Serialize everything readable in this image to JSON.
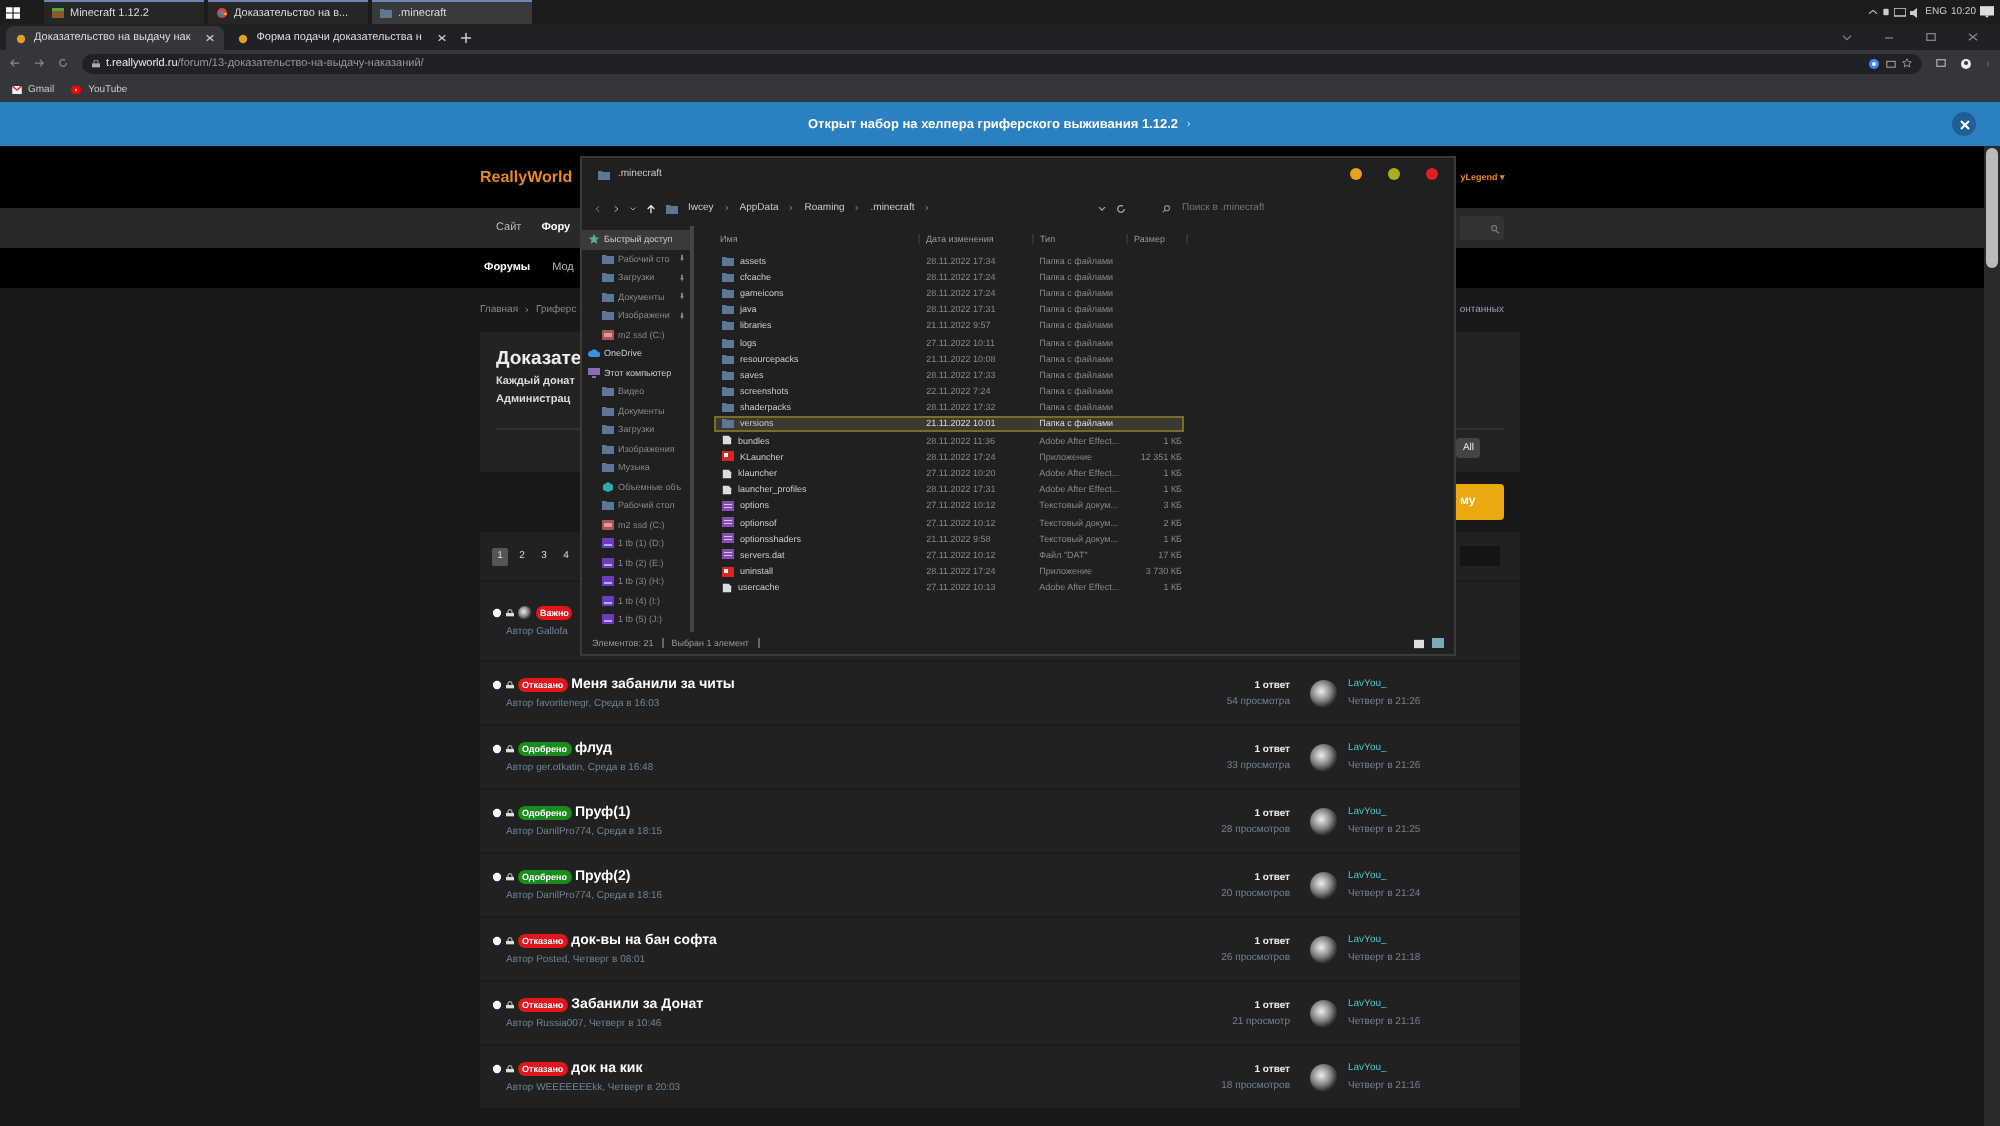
{
  "taskbar": {
    "apps": [
      {
        "label": "Minecraft 1.12.2",
        "kind": "minecraft",
        "selected": false
      },
      {
        "label": "Доказательство на в...",
        "kind": "chrome",
        "selected": false
      },
      {
        "label": ".minecraft",
        "kind": "folder",
        "selected": true
      }
    ],
    "tray": {
      "language": "ENG",
      "time": "10:20"
    }
  },
  "browser": {
    "tabs": [
      {
        "title": "Доказательство на выдачу нак",
        "selected": true
      },
      {
        "title": "Форма подачи доказательства н",
        "selected": false
      }
    ],
    "url_host": "t.reallyworld.ru",
    "url_path": "/forum/13-доказательство-на-выдачу-наказаний/",
    "bookmarks": [
      {
        "label": "Gmail",
        "kind": "gmail"
      },
      {
        "label": "YouTube",
        "kind": "youtube"
      }
    ]
  },
  "banner": {
    "text": "Открыт набор на хелпера гриферского выживания 1.12.2"
  },
  "site": {
    "logo": "ReallyWorld",
    "user": "yLegend ▾",
    "nav": [
      {
        "label": "Сайт",
        "selected": false
      },
      {
        "label": "Фору",
        "selected": true
      }
    ],
    "subnav": [
      {
        "label": "Форумы",
        "selected": true
      },
      {
        "label": "Мод",
        "selected": false
      }
    ],
    "breadcrumb": [
      "Главная",
      "Гриферс"
    ],
    "breadcrumb_tail": "онтанных",
    "title": "Доказате",
    "description": [
      "Каждый донат",
      "Администрац"
    ],
    "filter_button": "All",
    "new_button": "му",
    "pages": [
      {
        "label": "1",
        "selected": true
      },
      {
        "label": "2",
        "selected": false
      },
      {
        "label": "3",
        "selected": false
      },
      {
        "label": "4",
        "selected": false
      }
    ]
  },
  "threads": [
    {
      "badge": "Важно",
      "color": "#e0161b",
      "author": "Автор Gallofa"
    },
    {
      "badge": "Отказано",
      "color": "#e0161b",
      "title": "Меня забанили за читы",
      "author": "Автор favoritenegr, Среда в 16:03",
      "replies": "1 ответ",
      "views": "54 просмотра",
      "last_user": "LavYou_",
      "last_time": "Четверг в 21:26"
    },
    {
      "badge": "Одобрено",
      "color": "#1a8a1a",
      "title": "флуд",
      "author": "Автор ger.otkatin, Среда в 16:48",
      "replies": "1 ответ",
      "views": "33 просмотра",
      "last_user": "LavYou_",
      "last_time": "Четверг в 21:26"
    },
    {
      "badge": "Одобрено",
      "color": "#1a8a1a",
      "title": "Пруф(1)",
      "author": "Автор DanilPro774, Среда в 18:15",
      "replies": "1 ответ",
      "views": "28 просмотров",
      "last_user": "LavYou_",
      "last_time": "Четверг в 21:25"
    },
    {
      "badge": "Одобрено",
      "color": "#1a8a1a",
      "title": "Пруф(2)",
      "author": "Автор DanilPro774, Среда в 18:16",
      "replies": "1 ответ",
      "views": "20 просмотров",
      "last_user": "LavYou_",
      "last_time": "Четверг в 21:24"
    },
    {
      "badge": "Отказано",
      "color": "#e0161b",
      "title": "док-вы на бан софта",
      "author": "Автор Posted, Четверг в 08:01",
      "replies": "1 ответ",
      "views": "26 просмотров",
      "last_user": "LavYou_",
      "last_time": "Четверг в 21:18"
    },
    {
      "badge": "Отказано",
      "color": "#e0161b",
      "title": "Забанили за Донат",
      "author": "Автор Russia007, Четверг в 10:46",
      "replies": "1 ответ",
      "views": "21 просмотр",
      "last_user": "LavYou_",
      "last_time": "Четверг в 21:16"
    },
    {
      "badge": "Отказано",
      "color": "#e0161b",
      "title": "док на кик",
      "author": "Автор WEEEEEEEkk, Четверг в 20:03",
      "replies": "1 ответ",
      "views": "18 просмотров",
      "last_user": "LavYou_",
      "last_time": "Четверг в 21:16"
    }
  ],
  "explorer": {
    "title": ".minecraft",
    "path": [
      "Iwcey",
      "AppData",
      "Roaming",
      ".minecraft"
    ],
    "search_placeholder": "Поиск в .minecraft",
    "sidebar": [
      {
        "label": "Быстрый доступ",
        "kind": "quick",
        "selected": true,
        "children": [
          {
            "label": "Рабочий сто",
            "kind": "folder",
            "pinned": true,
            "selected": false
          },
          {
            "label": "Загрузки",
            "kind": "folder",
            "pinned": true,
            "selected": false
          },
          {
            "label": "Документы",
            "kind": "folder",
            "pinned": true,
            "selected": false
          },
          {
            "label": "Изображени",
            "kind": "folder",
            "pinned": true,
            "selected": false
          },
          {
            "label": "m2 ssd (C:)",
            "kind": "drive",
            "pinned": false,
            "selected": false
          }
        ]
      },
      {
        "label": "OneDrive",
        "kind": "cloud",
        "selected": false
      },
      {
        "label": "Этот компьютер",
        "kind": "pc",
        "selected": false,
        "children": [
          {
            "label": "Видео",
            "kind": "folder",
            "selected": false
          },
          {
            "label": "Документы",
            "kind": "folder",
            "selected": false
          },
          {
            "label": "Загрузки",
            "kind": "folder",
            "selected": false
          },
          {
            "label": "Изображения",
            "kind": "folder",
            "selected": false
          },
          {
            "label": "Музыка",
            "kind": "folder",
            "selected": false
          },
          {
            "label": "Объемные объ",
            "kind": "objects",
            "selected": false
          },
          {
            "label": "Рабочий стол",
            "kind": "folder",
            "selected": false
          },
          {
            "label": "m2 ssd (C:)",
            "kind": "drive",
            "selected": false
          },
          {
            "label": "1 tb (1) (D:)",
            "kind": "disk",
            "selected": false
          },
          {
            "label": "1 tb (2) (E:)",
            "kind": "disk",
            "selected": false
          },
          {
            "label": "1 tb (3) (H:)",
            "kind": "disk",
            "selected": false
          },
          {
            "label": "1 tb (4) (I:)",
            "kind": "disk",
            "selected": false
          },
          {
            "label": "1 tb (5) (J:)",
            "kind": "disk",
            "selected": false
          }
        ]
      }
    ],
    "columns": [
      "Имя",
      "Дата изменения",
      "Тип",
      "Размер"
    ],
    "files": [
      {
        "name": "assets",
        "date": "28.11.2022 17:34",
        "type": "Папка с файлами",
        "kind": "folder",
        "selected": false
      },
      {
        "name": "cfcache",
        "date": "28.11.2022 17:24",
        "type": "Папка с файлами",
        "kind": "folder",
        "selected": false
      },
      {
        "name": "gameicons",
        "date": "28.11.2022 17:24",
        "type": "Папка с файлами",
        "kind": "folder",
        "selected": false
      },
      {
        "name": "java",
        "date": "28.11.2022 17:31",
        "type": "Папка с файлами",
        "kind": "folder",
        "selected": false
      },
      {
        "name": "libraries",
        "date": "21.11.2022 9:57",
        "type": "Папка с файлами",
        "kind": "folder",
        "selected": false
      },
      {
        "name": "logs",
        "date": "27.11.2022 10:11",
        "type": "Папка с файлами",
        "kind": "folder",
        "selected": false
      },
      {
        "name": "resourcepacks",
        "date": "21.11.2022 10:08",
        "type": "Папка с файлами",
        "kind": "folder",
        "selected": false
      },
      {
        "name": "saves",
        "date": "28.11.2022 17:33",
        "type": "Папка с файлами",
        "kind": "folder",
        "selected": false
      },
      {
        "name": "screenshots",
        "date": "22.11.2022 7:24",
        "type": "Папка с файлами",
        "kind": "folder",
        "selected": false
      },
      {
        "name": "shaderpacks",
        "date": "28.11.2022 17:32",
        "type": "Папка с файлами",
        "kind": "folder",
        "selected": false
      },
      {
        "name": "versions",
        "date": "21.11.2022 10:01",
        "type": "Папка с файлами",
        "kind": "folder",
        "selected": true
      },
      {
        "name": "bundles",
        "date": "28.11.2022 11:36",
        "type": "Adobe After Effect...",
        "size": "1 КБ",
        "kind": "file",
        "selected": false
      },
      {
        "name": "KLauncher",
        "date": "28.11.2022 17:24",
        "type": "Приложение",
        "size": "12 351 КБ",
        "kind": "app",
        "selected": false
      },
      {
        "name": "klauncher",
        "date": "27.11.2022 10:20",
        "type": "Adobe After Effect...",
        "size": "1 КБ",
        "kind": "file",
        "selected": false
      },
      {
        "name": "launcher_profiles",
        "date": "28.11.2022 17:31",
        "type": "Adobe After Effect...",
        "size": "1 КБ",
        "kind": "file",
        "selected": false
      },
      {
        "name": "options",
        "date": "27.11.2022 10:12",
        "type": "Текстовый докум...",
        "size": "3 КБ",
        "kind": "text",
        "selected": false
      },
      {
        "name": "optionsof",
        "date": "27.11.2022 10:12",
        "type": "Текстовый докум...",
        "size": "2 КБ",
        "kind": "text",
        "selected": false
      },
      {
        "name": "optionsshaders",
        "date": "21.11.2022 9:58",
        "type": "Текстовый докум...",
        "size": "1 КБ",
        "kind": "text",
        "selected": false
      },
      {
        "name": "servers.dat",
        "date": "27.11.2022 10:12",
        "type": "Файл \"DAT\"",
        "size": "17 КБ",
        "kind": "text",
        "selected": false
      },
      {
        "name": "uninstall",
        "date": "28.11.2022 17:24",
        "type": "Приложение",
        "size": "3 730 КБ",
        "kind": "app",
        "selected": false
      },
      {
        "name": "usercache",
        "date": "27.11.2022 10:13",
        "type": "Adobe After Effect...",
        "size": "1 КБ",
        "kind": "file",
        "selected": false
      }
    ],
    "status": [
      "Элементов: 21",
      "Выбран 1 элемент"
    ]
  }
}
